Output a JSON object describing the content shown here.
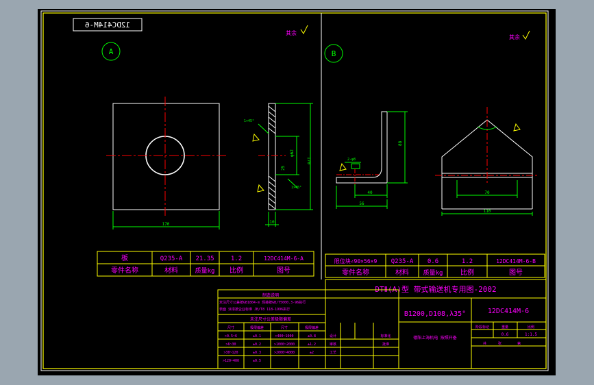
{
  "drawing": {
    "top_code": "12DC414M-6",
    "roughness_a": "其余",
    "roughness_b": "其余",
    "view_a": "A",
    "view_b": "B"
  },
  "part_a": {
    "dims": {
      "width": "170",
      "height": "170",
      "thickness": "10",
      "hole": "φ62",
      "chamfer": "25",
      "angle_top": "1×45°",
      "angle_bottom": "1×45°"
    },
    "table": {
      "name": "板",
      "material": "Q235-A",
      "weight": "21.35",
      "scale": "1.2",
      "drawing_no": "12DC414M-6-A"
    },
    "header": {
      "name": "零件名称",
      "material": "材料",
      "weight": "质量kg",
      "scale": "比例",
      "drawing_no": "图号"
    }
  },
  "part_b": {
    "dims": {
      "height": "88",
      "width": "40",
      "base": "56",
      "small": "2-φ8",
      "span": "70",
      "total": "110"
    },
    "table": {
      "name": "限位块∠90×56×9",
      "material": "Q235-A",
      "weight": "0.6",
      "scale": "1.2",
      "drawing_no": "12DC414M-6-B"
    },
    "header": {
      "name": "零件名称",
      "material": "材料",
      "weight": "质量kg",
      "scale": "比例",
      "drawing_no": "图号"
    }
  },
  "title_block": {
    "title": "DTⅡ(A)型  带式输送机专用图-2002",
    "spec": "B1200,D108,λ35°",
    "code": "12DC414M-6",
    "note_title": "制造说明",
    "note_line1": "未注尺寸公差按GB1804-m 焊接按GB/T5000.3-96执行",
    "note_line2": "表面 涂漆按企业标准 JB/T8 118-1996执行",
    "tol_title": "未注尺寸公差极限偏差",
    "tol_header": [
      "尺寸",
      "极限偏差",
      "尺寸",
      "极限偏差"
    ],
    "tol_rows": [
      [
        ">0.5~6",
        "±0.1",
        ">400~1000",
        "±0.8"
      ],
      [
        ">6~30",
        "±0.2",
        ">1000~2000",
        "±1.2"
      ],
      [
        ">30~120",
        "±0.3",
        ">2000~4000",
        "±2"
      ],
      [
        ">120~400",
        "±0.5",
        "",
        ""
      ]
    ],
    "sign_labels": [
      "设计",
      "审核",
      "工艺",
      "标准化",
      "批准"
    ],
    "stamp": "德阳上海机电 按照开备",
    "stage_label": "阶段标记",
    "weight_label": "重量",
    "scale_label": "比例",
    "scale_value": "1:1.5",
    "weight_value": "0.6",
    "sheet_label": "共",
    "sheet_label2": "张",
    "page_label": "第"
  }
}
